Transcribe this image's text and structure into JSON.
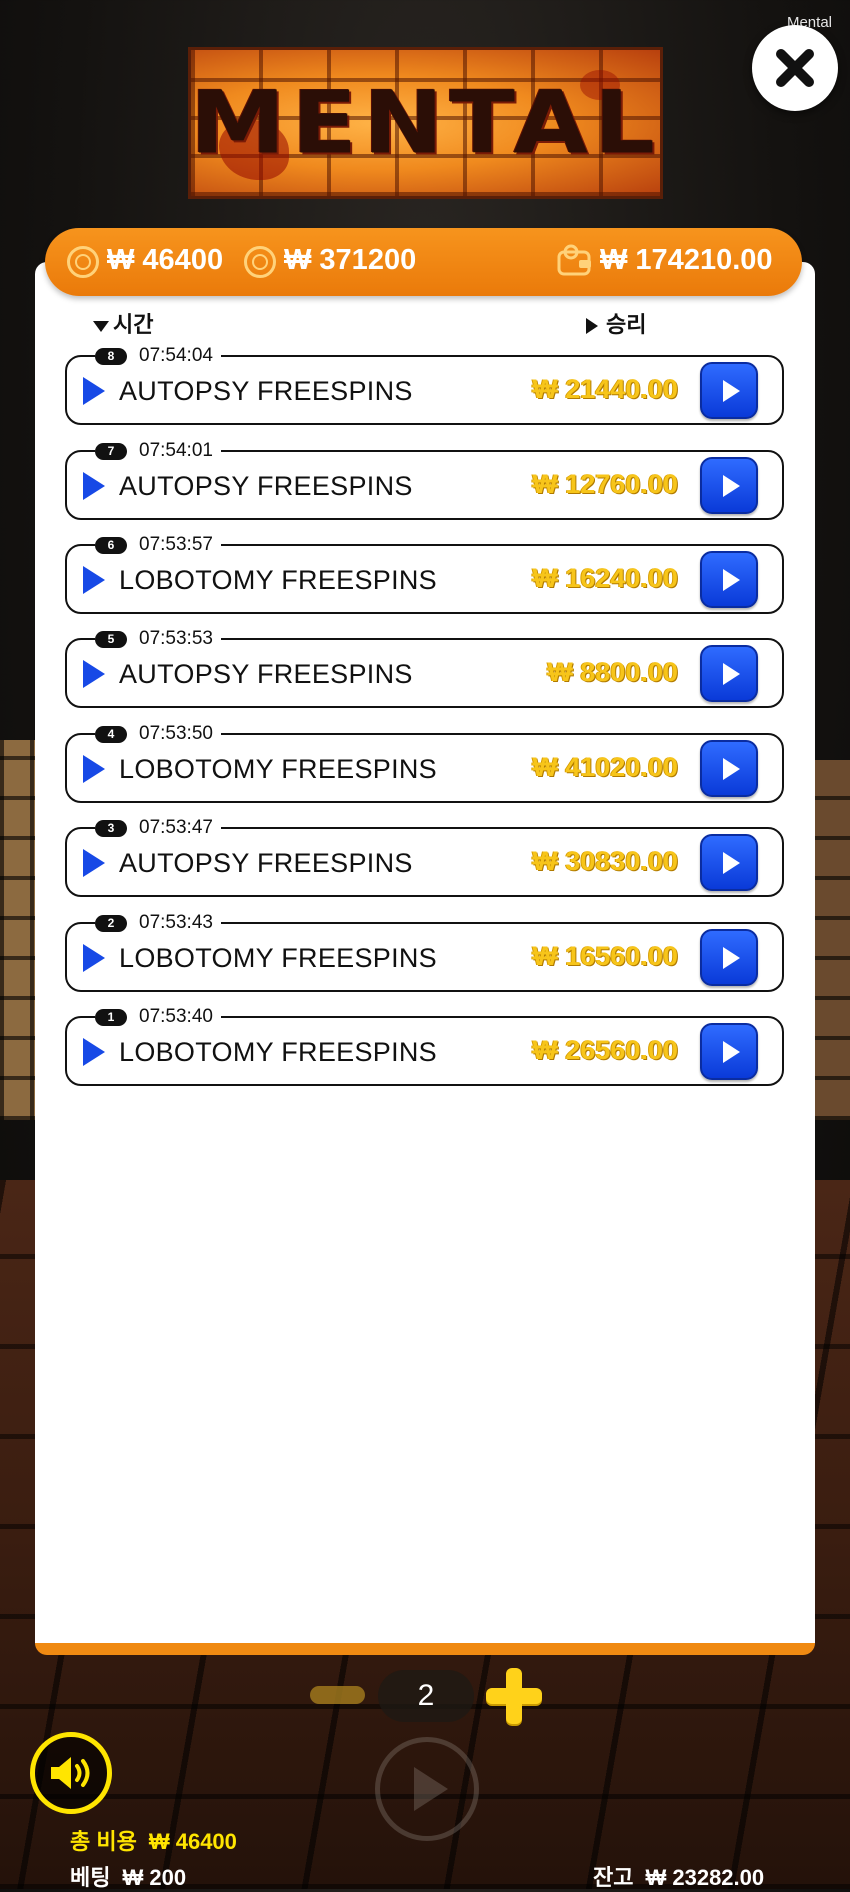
{
  "watermark": "Mental",
  "logo_text": "MENTAL",
  "topbar": {
    "total_cost": "₩ 46400",
    "total_win": "₩ 371200",
    "wallet": "₩ 174210.00"
  },
  "columns": {
    "time": "시간",
    "win": "승리"
  },
  "history": [
    {
      "num": "8",
      "time": "07:54:04",
      "title": "AUTOPSY FREESPINS",
      "win": "₩ 21440.00"
    },
    {
      "num": "7",
      "time": "07:54:01",
      "title": "AUTOPSY FREESPINS",
      "win": "₩ 12760.00"
    },
    {
      "num": "6",
      "time": "07:53:57",
      "title": "LOBOTOMY FREESPINS",
      "win": "₩ 16240.00"
    },
    {
      "num": "5",
      "time": "07:53:53",
      "title": "AUTOPSY FREESPINS",
      "win": "₩ 8800.00"
    },
    {
      "num": "4",
      "time": "07:53:50",
      "title": "LOBOTOMY FREESPINS",
      "win": "₩ 41020.00"
    },
    {
      "num": "3",
      "time": "07:53:47",
      "title": "AUTOPSY FREESPINS",
      "win": "₩ 30830.00"
    },
    {
      "num": "2",
      "time": "07:53:43",
      "title": "LOBOTOMY FREESPINS",
      "win": "₩ 16560.00"
    },
    {
      "num": "1",
      "time": "07:53:40",
      "title": "LOBOTOMY FREESPINS",
      "win": "₩ 26560.00"
    }
  ],
  "pagination": {
    "page": "2"
  },
  "footer": {
    "total_cost_label": "총 비용",
    "total_cost_value": "₩ 46400",
    "bet_label": "베팅",
    "bet_value": "₩ 200",
    "balance_label": "잔고",
    "balance_value": "₩ 23282.00"
  },
  "colors": {
    "accent_orange": "#f08a12",
    "replay_blue": "#1749e6",
    "win_gold": "#f7c51a",
    "footer_yellow": "#ffe500"
  },
  "icons": [
    "close-icon",
    "coin-icon",
    "wallet-icon",
    "sort-down-icon",
    "sort-right-icon",
    "play-icon",
    "minus-icon",
    "plus-icon",
    "spin-icon",
    "speaker-icon"
  ]
}
